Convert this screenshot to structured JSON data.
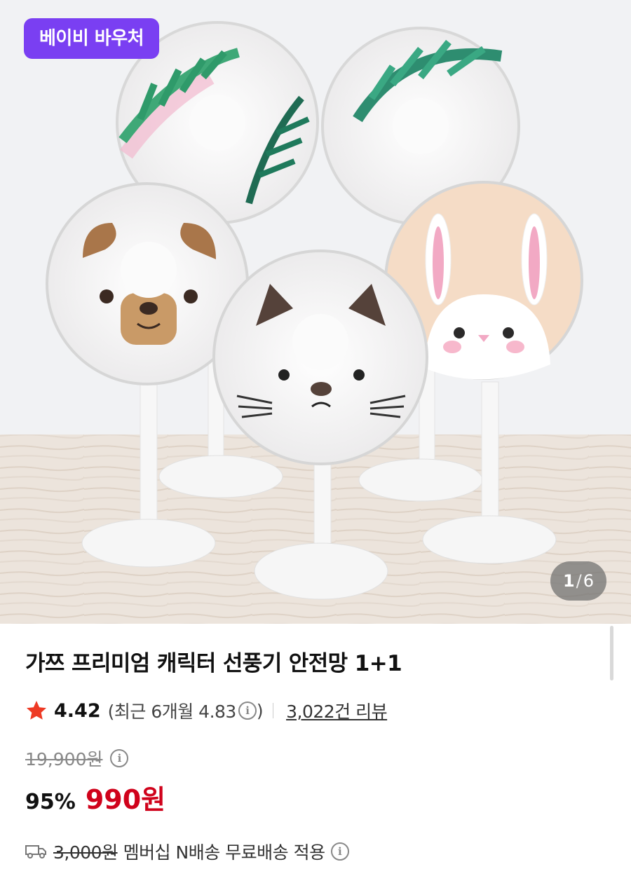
{
  "hero": {
    "badge": "베이비 바우처",
    "counter_current": "1",
    "counter_sep": "/",
    "counter_total": "6"
  },
  "product": {
    "title": "가쯔 프리미엄 캐릭터 선풍기 안전망 1+1",
    "rating": "4.42",
    "recent_rating": "(최근 6개월 4.83",
    "recent_close": ")",
    "reviews": "3,022건 리뷰",
    "original_price": "19,900원",
    "discount": "95%",
    "sale_price": "990원",
    "shipping_fee": "3,000원",
    "shipping_text": "멤버십 N배송 무료배송 적용"
  },
  "colors": {
    "accent": "#7a3ff2",
    "sale": "#d0021b",
    "star": "#ee3a24"
  },
  "icons": {
    "star": "star-icon",
    "info": "info-icon",
    "truck": "truck-icon"
  }
}
